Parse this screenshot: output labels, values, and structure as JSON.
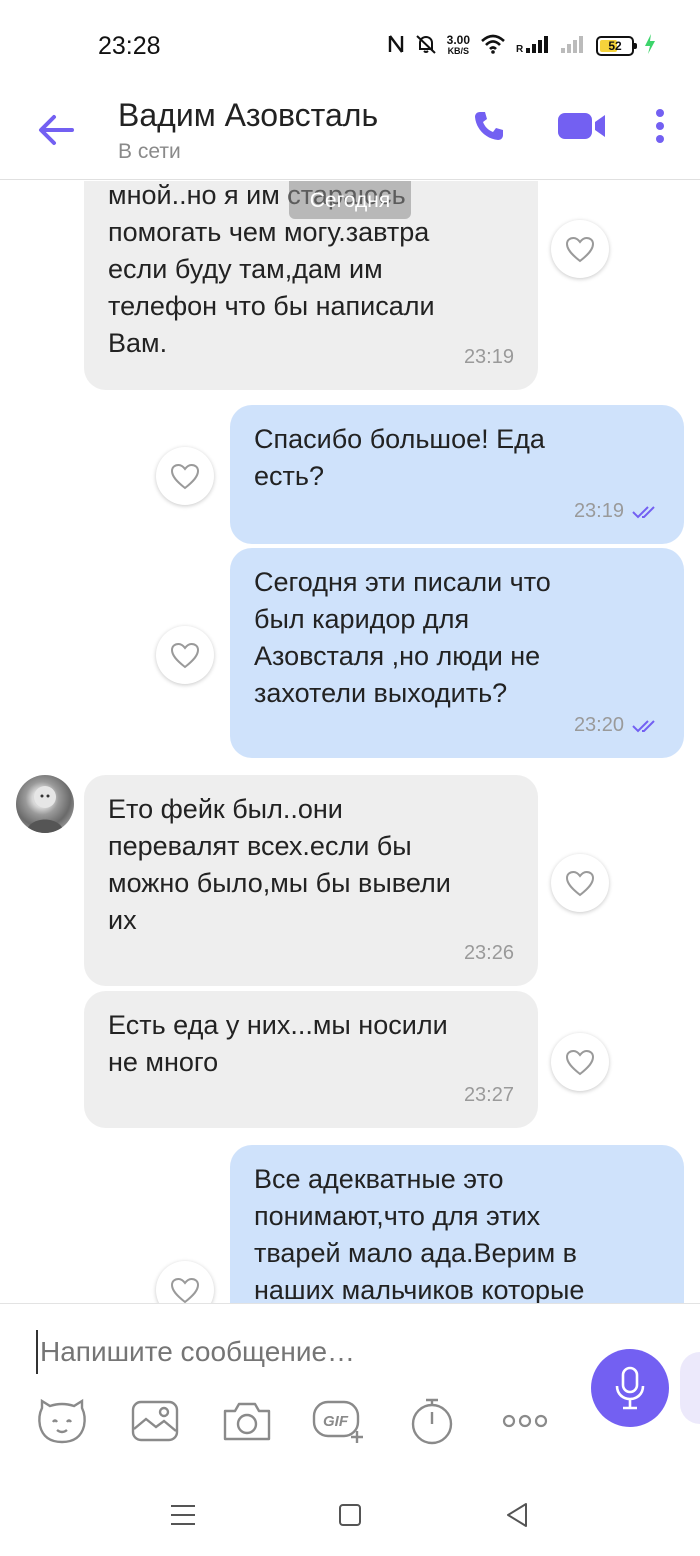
{
  "status_bar": {
    "time": "23:28",
    "speed_value": "3.00",
    "speed_unit": "KB/S",
    "battery": "52",
    "icons": [
      "nfc-icon",
      "mute-icon",
      "wifi-icon",
      "signal-icon",
      "signal-icon",
      "battery-icon",
      "charging-icon"
    ]
  },
  "header": {
    "contact_name": "Вадим Азовсталь",
    "status": "В сети"
  },
  "chat": {
    "date_separator": "Сегодня",
    "messages": [
      {
        "direction": "in",
        "text": "мной..но я им стараюсь\nпомогать чем могу.завтра\nесли буду там,дам им\nтелефон что бы написали\nВам.",
        "time": "23:19"
      },
      {
        "direction": "out",
        "text": "Спасибо большое! Еда\nесть?",
        "time": "23:19",
        "read": true
      },
      {
        "direction": "out",
        "text": "Сегодня эти писали что\nбыл каридор для\nАзовсталя ,но люди не\nзахотели выходить?",
        "time": "23:20",
        "read": true
      },
      {
        "direction": "in",
        "text": "Ето фейк был..они\nперевалят всех.если бы\nможно было,мы бы вывели\nих",
        "time": "23:26"
      },
      {
        "direction": "in",
        "text": "Есть еда у них...мы носили\nне много",
        "time": "23:27"
      },
      {
        "direction": "out",
        "text": "Все адекватные это\nпонимают,что для этих\nтварей мало ада.Верим в\nнаших мальчиков которые"
      }
    ]
  },
  "composer": {
    "placeholder": "Напишите сообщение…",
    "tools": [
      "sticker-icon",
      "gallery-icon",
      "camera-icon",
      "gif-icon",
      "timer-icon",
      "more-options-icon"
    ]
  },
  "colors": {
    "accent": "#7360f2",
    "incoming_bubble": "#eeeeee",
    "outgoing_bubble": "#cfe2fb"
  }
}
